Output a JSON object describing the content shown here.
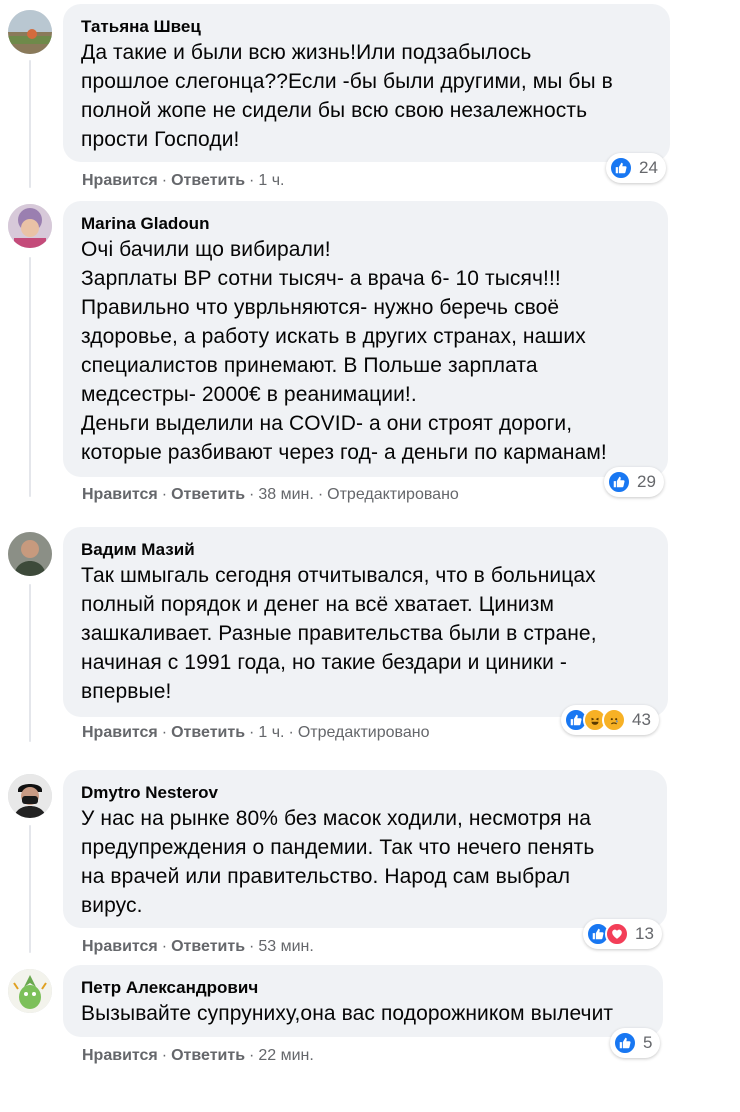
{
  "comments": [
    {
      "author": "Татьяна Швец",
      "text": "Да такие и были всю жизнь!Или подзабылось\nпрошлое слегонца??Если -бы были другими, мы бы в\nполной жопе не сидели бы всю свою незалежность\nпрости Господи!",
      "reactions": [
        "like"
      ],
      "reaction_count": "24",
      "like_label": "Нравится",
      "reply_label": "Ответить",
      "time": "1 ч.",
      "edited": ""
    },
    {
      "author": "Marina Gladoun",
      "text": "Очі бачили що вибирали!\nЗарплаты ВР сотни тысяч- а врача 6- 10 тысяч!!!\nПравильно что уврльняются- нужно беречь своё\nздоровье, а работу искать в других странах, наших\nспециалистов принемают. В Польше зарплата\nмедсестры- 2000€ в реанимации!.\nДеньги выделили на COVID- а они строят дороги,\nкоторые разбивают через год- а деньги по карманам!",
      "reactions": [
        "like"
      ],
      "reaction_count": "29",
      "like_label": "Нравится",
      "reply_label": "Ответить",
      "time": "38 мин.",
      "edited": "Отредактировано"
    },
    {
      "author": "Вадим Мазий",
      "text": "Так шмыгаль сегодня отчитывался, что в больницах\nполный порядок и денег на всё хватает. Цинизм\nзашкаливает. Разные правительства были в стране,\nначиная с 1991 года, но такие бездари и циники -\nвпервые!",
      "reactions": [
        "like",
        "haha",
        "sad"
      ],
      "reaction_count": "43",
      "like_label": "Нравится",
      "reply_label": "Ответить",
      "time": "1 ч.",
      "edited": "Отредактировано"
    },
    {
      "author": "Dmytro Nesterov",
      "text": "У нас на рынке 80% без масок ходили, несмотря на\nпредупреждения о пандемии. Так что нечего пенять\nна врачей или правительство. Народ сам выбрал\nвирус.",
      "reactions": [
        "like",
        "love"
      ],
      "reaction_count": "13",
      "like_label": "Нравится",
      "reply_label": "Ответить",
      "time": "53 мин.",
      "edited": ""
    },
    {
      "author": "Петр Александрович",
      "text": "Вызывайте супруниху,она вас подорожником вылечит",
      "reactions": [
        "like"
      ],
      "reaction_count": "5",
      "like_label": "Нравится",
      "reply_label": "Ответить",
      "time": "22 мин.",
      "edited": ""
    }
  ],
  "colors": {
    "bubble": "#f0f2f5",
    "meta_text": "#65676b",
    "like_blue": "#1877f2",
    "love_red": "#f33e58",
    "emoji_yellow": "#f7b125"
  },
  "icons": {
    "like": "thumbs-up-icon",
    "love": "heart-icon",
    "haha": "laughing-face-icon",
    "sad": "sad-face-icon"
  }
}
